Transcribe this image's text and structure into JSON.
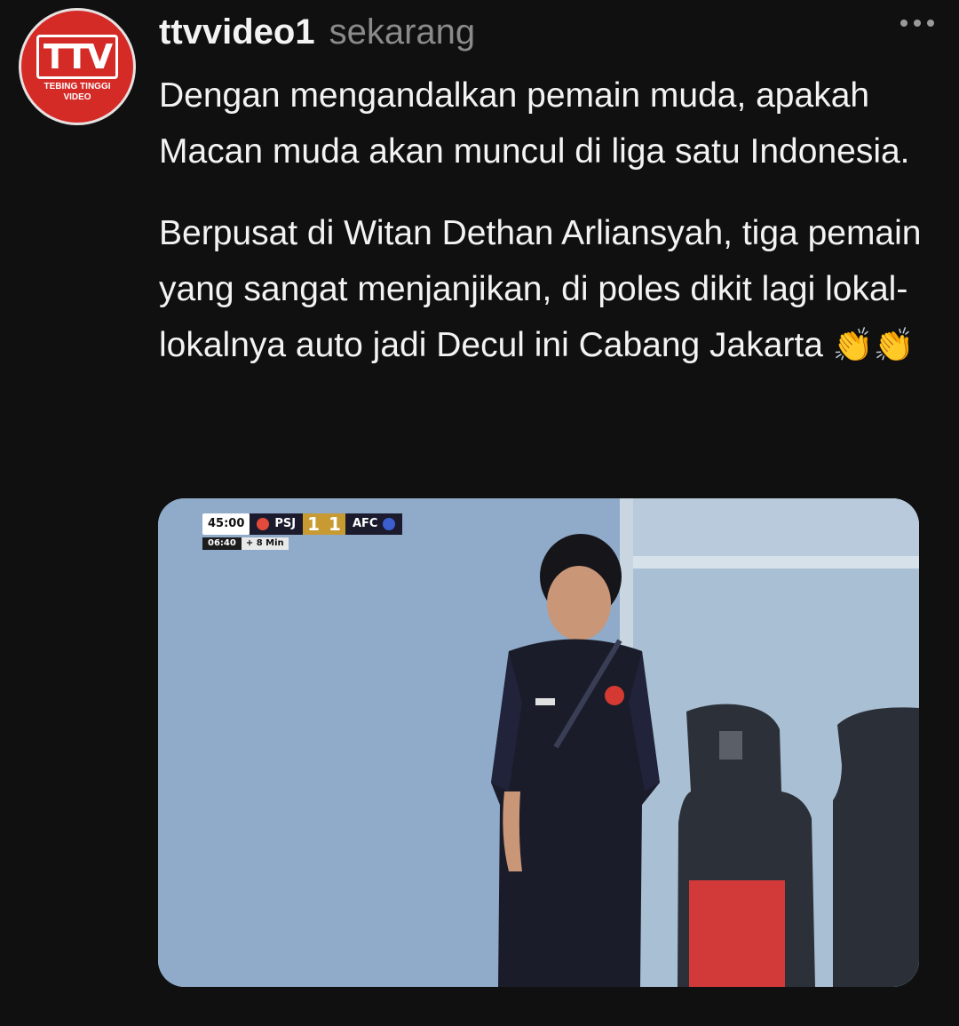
{
  "post": {
    "avatar": {
      "logo_text": "TTV",
      "tagline": "TEBING TINGGI VIDEO"
    },
    "username": "ttvvideo1",
    "timestamp": "sekarang",
    "more_icon": "more-horizontal-icon",
    "paragraphs": [
      "Dengan mengandalkan pemain muda, apakah Macan muda akan muncul di liga satu Indonesia.",
      "Berpusat di Witan Dethan Arliansyah, tiga pemain yang sangat menjanjikan, di poles dikit lagi lokal-lokalnya auto jadi Decul ini Cabang Jakarta"
    ],
    "emoji": "👏👏"
  },
  "media": {
    "scorebug": {
      "clock": "45:00",
      "home": "PSJ",
      "home_score": "1",
      "away_score": "1",
      "away": "AFC",
      "sub_time": "06:40",
      "added_time": "+ 8 Min"
    }
  },
  "colors": {
    "background": "#101010",
    "avatar_red": "#d52b27",
    "muted_text": "#8a8a8a"
  }
}
